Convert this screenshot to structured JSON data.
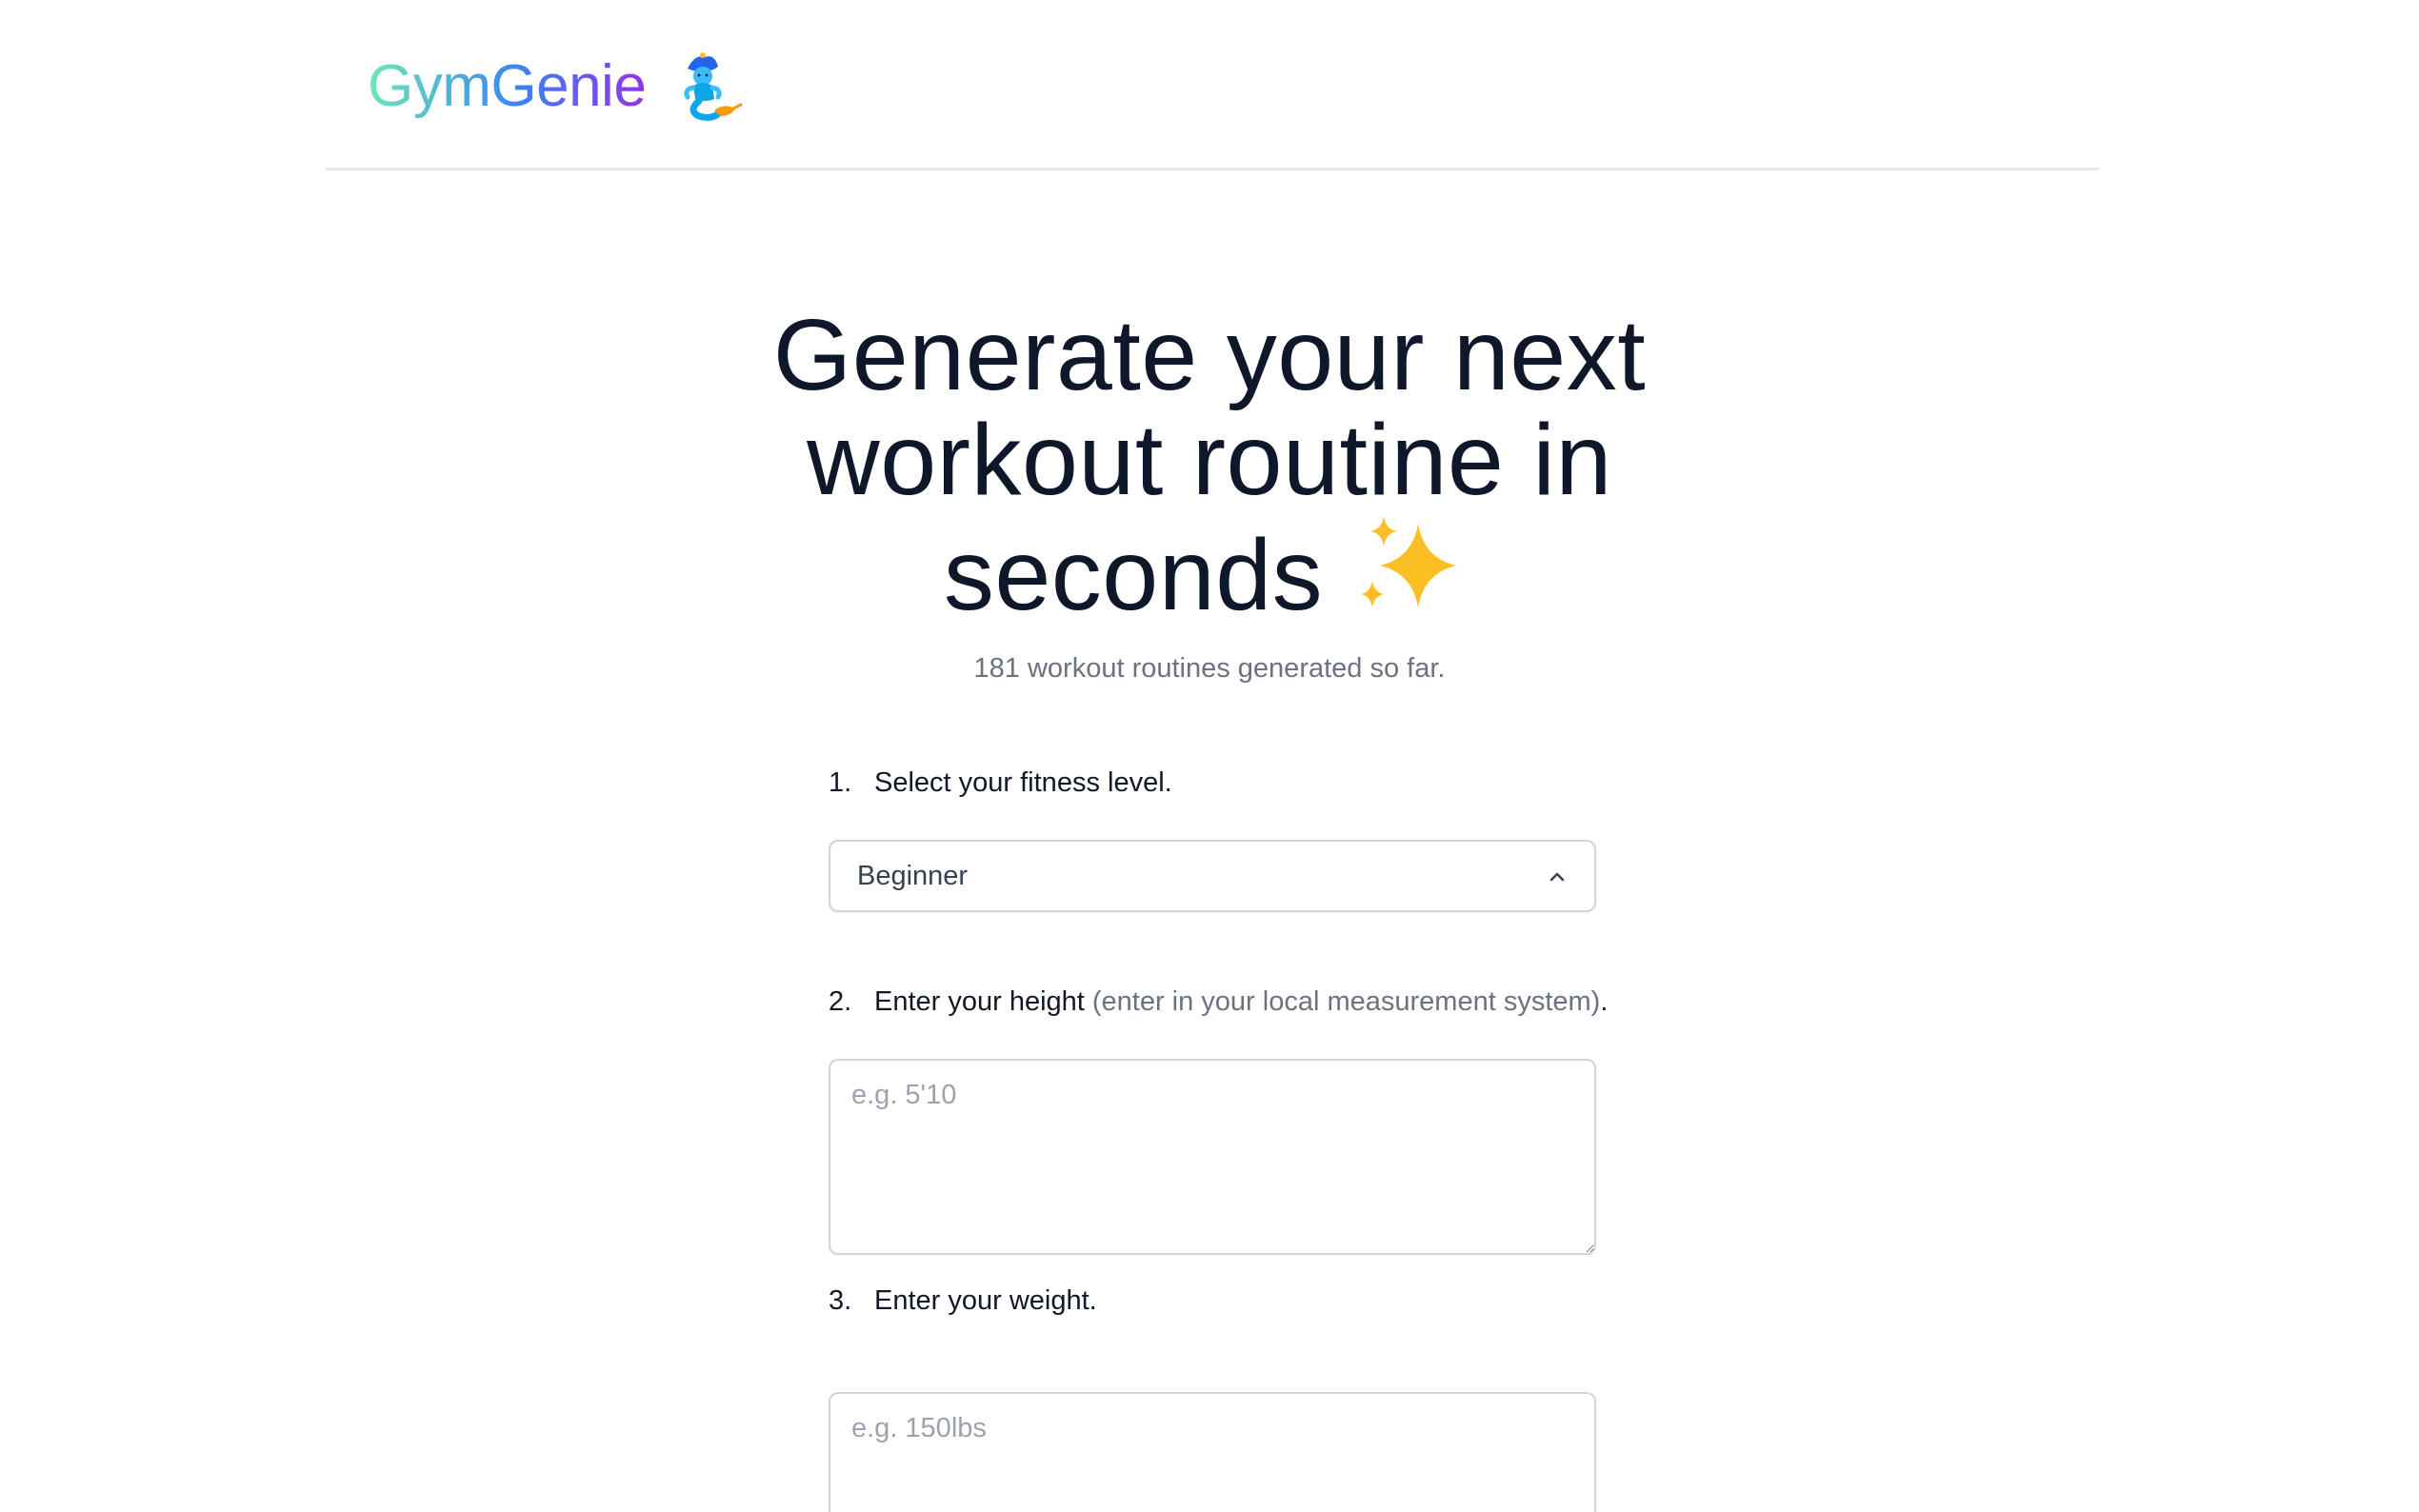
{
  "header": {
    "logo_text": "GymGenie",
    "logo_icon": "genie-icon"
  },
  "hero": {
    "title_text": "Generate your next workout routine in seconds",
    "title_icon": "sparkles-icon",
    "counter_text": "181 workout routines generated so far."
  },
  "form": {
    "step1": {
      "number": "1.",
      "label": "Select your fitness level.",
      "selected_value": "Beginner"
    },
    "step2": {
      "number": "2.",
      "label": "Enter your height",
      "hint": "(enter in your local measurement system)",
      "suffix": ".",
      "placeholder": "e.g. 5'10"
    },
    "step3": {
      "number": "3.",
      "label": "Enter your weight.",
      "placeholder": "e.g. 150lbs"
    }
  },
  "colors": {
    "text_primary": "#0f172a",
    "text_muted": "#6b7280",
    "border": "#d1d5db",
    "logo_gradient_start": "#6ee7b7",
    "logo_gradient_end": "#9333ea"
  }
}
